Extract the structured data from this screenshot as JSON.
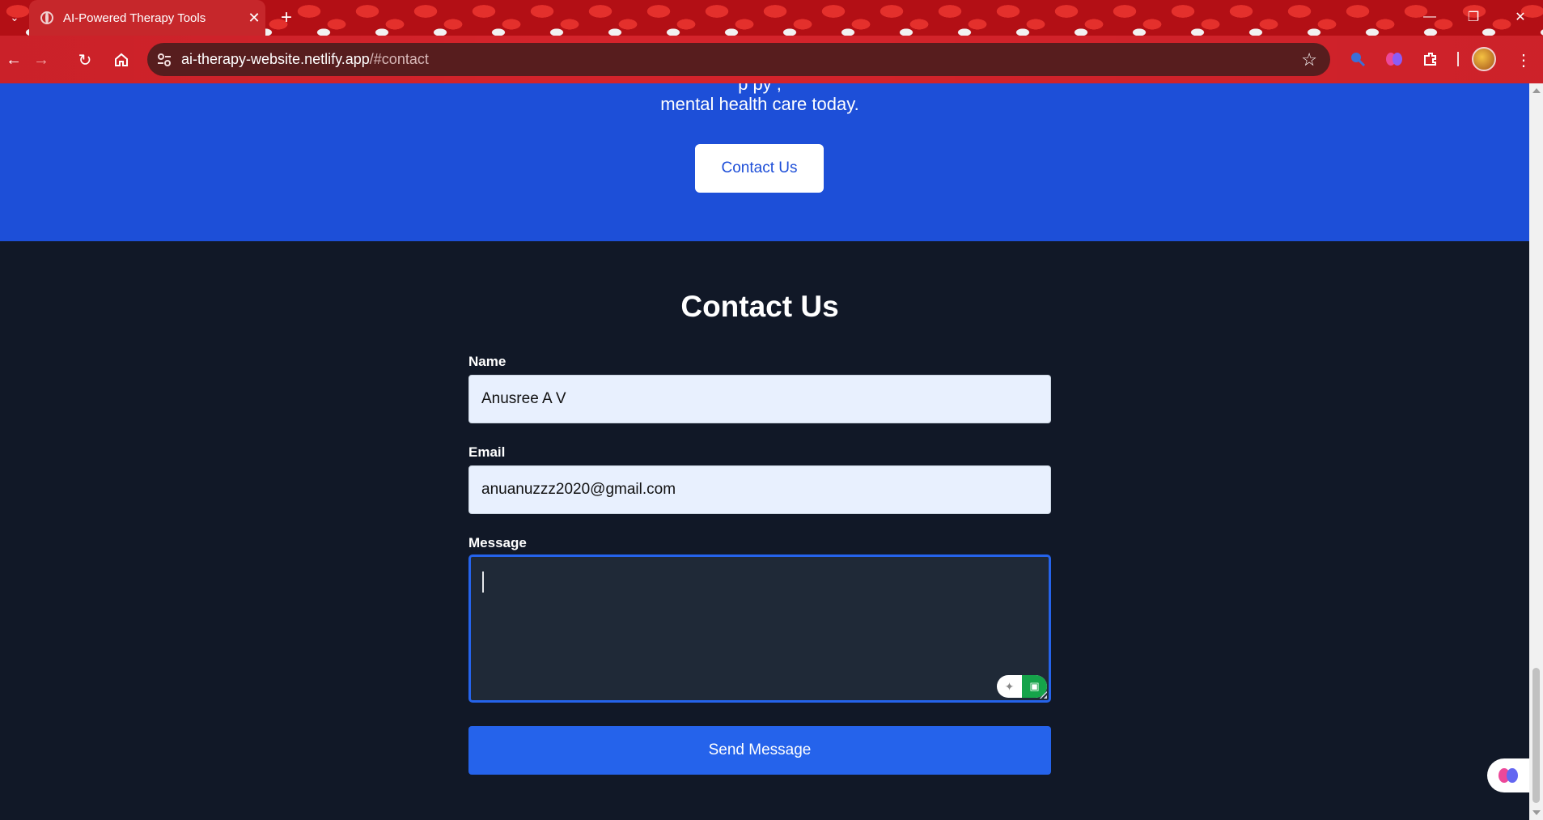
{
  "browser": {
    "tab_title": "AI-Powered Therapy Tools",
    "url_host": "ai-therapy-website.netlify.app",
    "url_path": "/#contact",
    "icons": [
      "back-icon",
      "forward-icon",
      "reload-icon",
      "home-icon",
      "site-settings-icon",
      "bookmark-star-icon",
      "search-extension-icon",
      "brain-extension-icon",
      "extensions-puzzle-icon",
      "profile-avatar",
      "menu-kebab-icon"
    ]
  },
  "cta": {
    "line_partial": "p                              py                   ,",
    "line": "mental health care today.",
    "button_label": "Contact Us"
  },
  "contact": {
    "title": "Contact Us",
    "name_label": "Name",
    "name_value": "Anusree A V",
    "email_label": "Email",
    "email_value": "anuanuzzz2020@gmail.com",
    "message_label": "Message",
    "message_value": "",
    "send_label": "Send Message"
  },
  "colors": {
    "cta_background": "#1d4fd8",
    "page_background": "#111827",
    "button_blue": "#2563eb",
    "browser_accent": "#d5232b"
  }
}
